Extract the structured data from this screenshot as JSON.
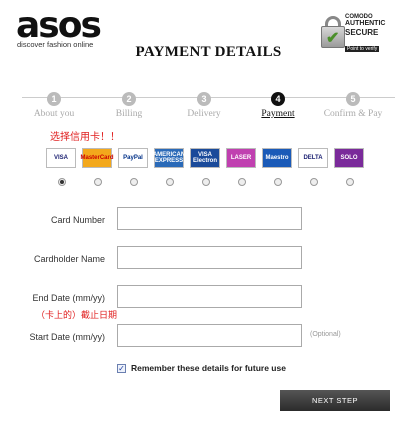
{
  "brand": {
    "logo_text": "asos",
    "tagline": "discover fashion online"
  },
  "seal": {
    "issuer": "COMODO",
    "line1": "AUTHENTIC",
    "line2": "SECURE",
    "verify": "Point to verify"
  },
  "page_title": "PAYMENT DETAILS",
  "steps": [
    {
      "num": "1",
      "label": "About you",
      "active": false
    },
    {
      "num": "2",
      "label": "Billing",
      "active": false
    },
    {
      "num": "3",
      "label": "Delivery",
      "active": false
    },
    {
      "num": "4",
      "label": "Payment",
      "active": true
    },
    {
      "num": "5",
      "label": "Confirm & Pay",
      "active": false
    }
  ],
  "annotation_select_card": "选择信用卡！！",
  "cards": [
    {
      "label": "VISA",
      "bg": "#ffffff",
      "fg": "#1a1f71",
      "selected": true
    },
    {
      "label": "MasterCard",
      "bg": "#f3a81c",
      "fg": "#cc0000",
      "selected": false
    },
    {
      "label": "PayPal",
      "bg": "#ffffff",
      "fg": "#003087",
      "selected": false
    },
    {
      "label": "AMERICAN EXPRESS",
      "bg": "#2a6ab8",
      "fg": "#ffffff",
      "selected": false
    },
    {
      "label": "VISA Electron",
      "bg": "#1a4a9a",
      "fg": "#ffffff",
      "selected": false
    },
    {
      "label": "LASER",
      "bg": "#c040b0",
      "fg": "#ffffff",
      "selected": false
    },
    {
      "label": "Maestro",
      "bg": "#1a5ab8",
      "fg": "#ffffff",
      "selected": false
    },
    {
      "label": "DELTA",
      "bg": "#ffffff",
      "fg": "#1a1f71",
      "selected": false
    },
    {
      "label": "SOLO",
      "bg": "#7a2a9a",
      "fg": "#ffffff",
      "selected": false
    }
  ],
  "form": {
    "card_number_label": "Card Number",
    "cardholder_label": "Cardholder Name",
    "end_date_label": "End Date (mm/yy)",
    "end_date_annotation": "（卡上的）截止日期",
    "start_date_label": "Start Date (mm/yy)",
    "optional_text": "(Optional)"
  },
  "remember_label": "Remember these details for future use",
  "remember_checked": true,
  "next_button": "NEXT STEP"
}
